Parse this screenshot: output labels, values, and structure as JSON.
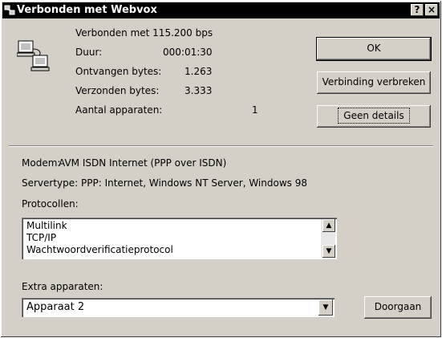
{
  "window": {
    "title": "Verbonden met Webvox",
    "help_label": "?",
    "close_label": "×"
  },
  "status": {
    "connected_line": "Verbonden met 115.200 bps",
    "duration_label": "Duur:",
    "duration_value": "000:01:30",
    "received_label": "Ontvangen bytes:",
    "received_value": "1.263",
    "sent_label": "Verzonden bytes:",
    "sent_value": "3.333",
    "devices_label": "Aantal apparaten:",
    "devices_value": "1"
  },
  "buttons": {
    "ok": "OK",
    "disconnect": "Verbinding verbreken",
    "details": "Geen details",
    "go": "Doorgaan"
  },
  "details": {
    "modem_label": "Modem:",
    "modem_value": "AVM ISDN Internet (PPP over ISDN)",
    "servertype_label": "Servertype:",
    "servertype_value": "PPP: Internet, Windows NT Server, Windows 98",
    "protocols_label": "Protocollen:",
    "protocols": [
      "Multilink",
      "TCP/IP",
      "Wachtwoordverificatieprotocol"
    ],
    "extra_devices_label": "Extra apparaten:",
    "extra_devices_selected": "Apparaat 2"
  },
  "icons": {
    "title_icon": "network-connection-icon",
    "status_icon": "computers-connected-icon",
    "scroll_up": "arrow-up-icon",
    "scroll_down": "arrow-down-icon",
    "dropdown": "chevron-down-icon"
  }
}
